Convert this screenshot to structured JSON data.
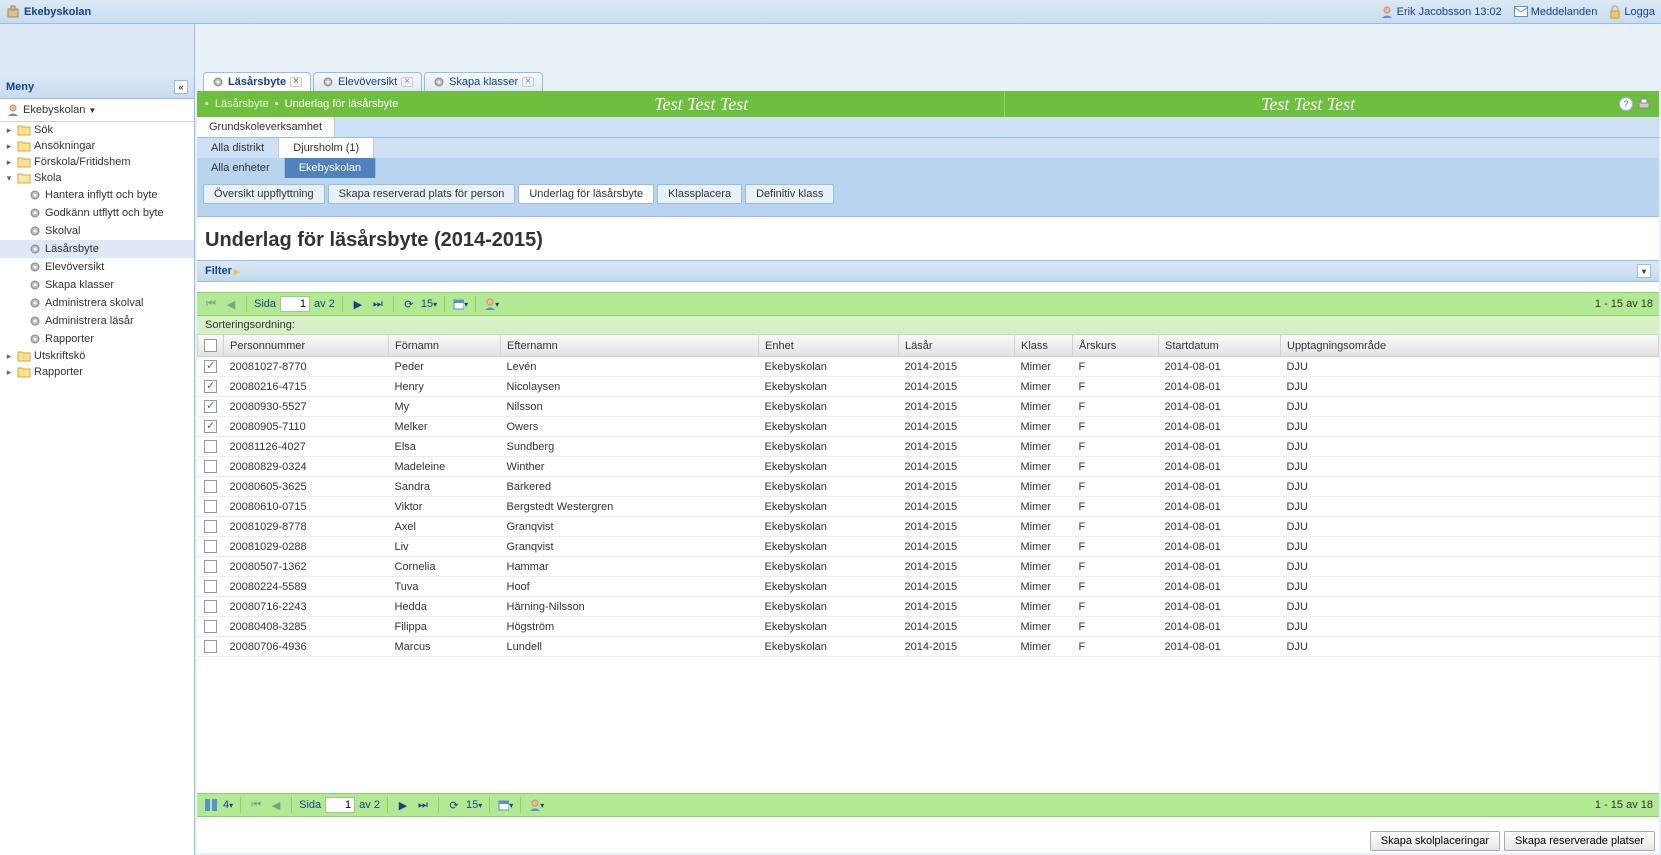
{
  "header": {
    "org": "Ekebyskolan",
    "user": "Erik Jacobsson",
    "time": "13:02",
    "messages": "Meddelanden",
    "logout": "Logga"
  },
  "sidebar": {
    "title": "Meny",
    "org": "Ekebyskolan",
    "tree": [
      {
        "label": "Sök",
        "type": "folder",
        "level": 1
      },
      {
        "label": "Ansökningar",
        "type": "folder",
        "level": 1
      },
      {
        "label": "Förskola/Fritidshem",
        "type": "folder",
        "level": 1
      },
      {
        "label": "Skola",
        "type": "folder-open",
        "level": 1
      },
      {
        "label": "Hantera inflytt och byte",
        "type": "leaf",
        "level": 2
      },
      {
        "label": "Godkänn utflytt och byte",
        "type": "leaf",
        "level": 2
      },
      {
        "label": "Skolval",
        "type": "leaf",
        "level": 2
      },
      {
        "label": "Läsårsbyte",
        "type": "leaf",
        "level": 2,
        "selected": true
      },
      {
        "label": "Elevöversikt",
        "type": "leaf",
        "level": 2
      },
      {
        "label": "Skapa klasser",
        "type": "leaf",
        "level": 2
      },
      {
        "label": "Administrera skolval",
        "type": "leaf",
        "level": 2
      },
      {
        "label": "Administrera läsår",
        "type": "leaf",
        "level": 2
      },
      {
        "label": "Rapporter",
        "type": "leaf",
        "level": 2
      },
      {
        "label": "Utskriftskö",
        "type": "folder",
        "level": 1
      },
      {
        "label": "Rapporter",
        "type": "folder",
        "level": 1
      }
    ]
  },
  "tabs": [
    {
      "label": "Läsårsbyte",
      "active": true
    },
    {
      "label": "Elevöversikt",
      "active": false
    },
    {
      "label": "Skapa klasser",
      "active": false
    }
  ],
  "breadcrumb": {
    "root": "Läsårsbyte",
    "current": "Underlag för läsårsbyte"
  },
  "banner": "Test Test Test",
  "verksamhet": {
    "tabs": [
      "Grundskoleverksamhet"
    ],
    "active": 0
  },
  "distrikt": {
    "tabs": [
      "Alla distrikt",
      "Djursholm  (1)"
    ],
    "active": 1
  },
  "enhet": {
    "tabs": [
      "Alla enheter",
      "Ekebyskolan"
    ],
    "active": 1
  },
  "actions": {
    "tabs": [
      "Översikt uppflyttning",
      "Skapa reserverad plats för person",
      "Underlag för läsårsbyte",
      "Klassplacera",
      "Definitiv klass"
    ],
    "active": 2
  },
  "page": {
    "title": "Underlag för läsårsbyte (2014-2015)",
    "filter_label": "Filter",
    "sort_label": "Sorteringsordning:"
  },
  "toolbar": {
    "page_label": "Sida",
    "page": "1",
    "of": "av 2",
    "pagesize": "15",
    "status": "1 - 15 av 18",
    "selector": "4"
  },
  "columns": [
    "",
    "Personnummer",
    "Förnamn",
    "Efternamn",
    "Enhet",
    "Läsår",
    "Klass",
    "Årskurs",
    "Startdatum",
    "Upptagningsområde"
  ],
  "rows": [
    {
      "checked": true,
      "cells": [
        "20081027-8770",
        "Peder",
        "Levén",
        "Ekebyskolan",
        "2014-2015",
        "Mimer",
        "F",
        "2014-08-01",
        "DJU"
      ]
    },
    {
      "checked": true,
      "cells": [
        "20080216-4715",
        "Henry",
        "Nicolaysen",
        "Ekebyskolan",
        "2014-2015",
        "Mimer",
        "F",
        "2014-08-01",
        "DJU"
      ]
    },
    {
      "checked": true,
      "cells": [
        "20080930-5527",
        "My",
        "Nilsson",
        "Ekebyskolan",
        "2014-2015",
        "Mimer",
        "F",
        "2014-08-01",
        "DJU"
      ]
    },
    {
      "checked": true,
      "cells": [
        "20080905-7110",
        "Melker",
        "Owers",
        "Ekebyskolan",
        "2014-2015",
        "Mimer",
        "F",
        "2014-08-01",
        "DJU"
      ]
    },
    {
      "checked": false,
      "cells": [
        "20081126-4027",
        "Elsa",
        "Sundberg",
        "Ekebyskolan",
        "2014-2015",
        "Mimer",
        "F",
        "2014-08-01",
        "DJU"
      ]
    },
    {
      "checked": false,
      "cells": [
        "20080829-0324",
        "Madeleine",
        "Winther",
        "Ekebyskolan",
        "2014-2015",
        "Mimer",
        "F",
        "2014-08-01",
        "DJU"
      ]
    },
    {
      "checked": false,
      "cells": [
        "20080605-3625",
        "Sandra",
        "Barkered",
        "Ekebyskolan",
        "2014-2015",
        "Mimer",
        "F",
        "2014-08-01",
        "DJU"
      ]
    },
    {
      "checked": false,
      "cells": [
        "20080610-0715",
        "Viktor",
        "Bergstedt Westergren",
        "Ekebyskolan",
        "2014-2015",
        "Mimer",
        "F",
        "2014-08-01",
        "DJU"
      ]
    },
    {
      "checked": false,
      "cells": [
        "20081029-8778",
        "Axel",
        "Granqvist",
        "Ekebyskolan",
        "2014-2015",
        "Mimer",
        "F",
        "2014-08-01",
        "DJU"
      ]
    },
    {
      "checked": false,
      "cells": [
        "20081029-0288",
        "Liv",
        "Granqvist",
        "Ekebyskolan",
        "2014-2015",
        "Mimer",
        "F",
        "2014-08-01",
        "DJU"
      ]
    },
    {
      "checked": false,
      "cells": [
        "20080507-1362",
        "Cornelia",
        "Hammar",
        "Ekebyskolan",
        "2014-2015",
        "Mimer",
        "F",
        "2014-08-01",
        "DJU"
      ]
    },
    {
      "checked": false,
      "cells": [
        "20080224-5589",
        "Tuva",
        "Hoof",
        "Ekebyskolan",
        "2014-2015",
        "Mimer",
        "F",
        "2014-08-01",
        "DJU"
      ]
    },
    {
      "checked": false,
      "cells": [
        "20080716-2243",
        "Hedda",
        "Härning-Nilsson",
        "Ekebyskolan",
        "2014-2015",
        "Mimer",
        "F",
        "2014-08-01",
        "DJU"
      ]
    },
    {
      "checked": false,
      "cells": [
        "20080408-3285",
        "Filippa",
        "Högström",
        "Ekebyskolan",
        "2014-2015",
        "Mimer",
        "F",
        "2014-08-01",
        "DJU"
      ]
    },
    {
      "checked": false,
      "cells": [
        "20080706-4936",
        "Marcus",
        "Lundell",
        "Ekebyskolan",
        "2014-2015",
        "Mimer",
        "F",
        "2014-08-01",
        "DJU"
      ]
    }
  ],
  "buttons": {
    "create_placements": "Skapa skolplaceringar",
    "create_reserved": "Skapa reserverade platser"
  }
}
